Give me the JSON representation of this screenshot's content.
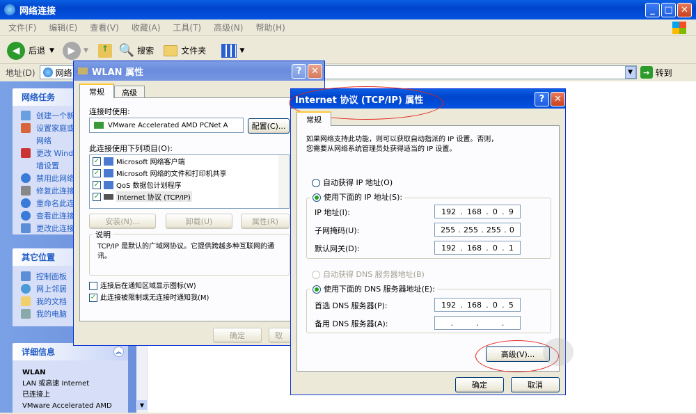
{
  "explorer": {
    "title": "网络连接",
    "menu": [
      "文件(F)",
      "编辑(E)",
      "查看(V)",
      "收藏(A)",
      "工具(T)",
      "高级(N)",
      "帮助(H)"
    ],
    "back_label": "后退",
    "search_label": "搜索",
    "folders_label": "文件夹",
    "address_label": "地址(D)",
    "address_value": "网络",
    "go_label": "转到"
  },
  "sidebar": {
    "network_tasks_title": "网络任务",
    "network_tasks": [
      "创建一个新",
      "设置家庭或",
      "网络",
      "更改 Windows",
      "墙设置",
      "禁用此网络",
      "修复此连接",
      "重命名此连",
      "查看此连接",
      "更改此连接"
    ],
    "other_places_title": "其它位置",
    "other_places": [
      "控制面板",
      "网上邻居",
      "我的文档",
      "我的电脑"
    ],
    "details_title": "详细信息",
    "details_name": "WLAN",
    "details_lines": [
      "LAN 或高速 Internet",
      "已连接上",
      "VMware Accelerated AMD"
    ]
  },
  "wlan_dialog": {
    "title": "WLAN 属性",
    "tabs": [
      "常规",
      "高级"
    ],
    "connect_using_label": "连接时使用:",
    "adapter_name": "VMware Accelerated AMD PCNet A",
    "configure_label": "配置(C)...",
    "items_label": "此连接使用下列项目(O):",
    "items": [
      "Microsoft 网络客户端",
      "Microsoft 网络的文件和打印机共享",
      "QoS 数据包计划程序",
      "Internet 协议 (TCP/IP)"
    ],
    "install_label": "安装(N)...",
    "uninstall_label": "卸载(U)",
    "properties_label": "属性(R)",
    "description_title": "说明",
    "description_text": "TCP/IP 是默认的广域网协议。它提供跨越多种互联网的通讯。",
    "show_icon_label": "连接后在通知区域显示图标(W)",
    "notify_label": "此连接被限制或无连接时通知我(M)",
    "ok_label": "确定",
    "cancel_label": "取"
  },
  "tcp_dialog": {
    "title": "Internet 协议 (TCP/IP) 属性",
    "tab": "常规",
    "intro": "如果网络支持此功能，则可以获取自动指派的 IP 设置。否则，",
    "intro2": "您需要从网络系统管理员处获得适当的 IP 设置。",
    "auto_ip_label": "自动获得 IP 地址(O)",
    "manual_ip_label": "使用下面的 IP 地址(S):",
    "ip_label": "IP 地址(I):",
    "ip_value": [
      "192",
      "168",
      "0",
      "9"
    ],
    "mask_label": "子网掩码(U):",
    "mask_value": [
      "255",
      "255",
      "255",
      "0"
    ],
    "gateway_label": "默认网关(D):",
    "gateway_value": [
      "192",
      "168",
      "0",
      "1"
    ],
    "auto_dns_label": "自动获得 DNS 服务器地址(B)",
    "manual_dns_label": "使用下面的 DNS 服务器地址(E):",
    "dns1_label": "首选 DNS 服务器(P):",
    "dns1_value": [
      "192",
      "168",
      "0",
      "5"
    ],
    "dns2_label": "备用 DNS 服务器(A):",
    "dns2_value": [
      ".",
      ".",
      "."
    ],
    "advanced_label": "高级(V)...",
    "ok_label": "确定",
    "cancel_label": "取消"
  },
  "colors": {
    "xp_blue": "#0453e0",
    "highlight_red": "#e2251c"
  }
}
